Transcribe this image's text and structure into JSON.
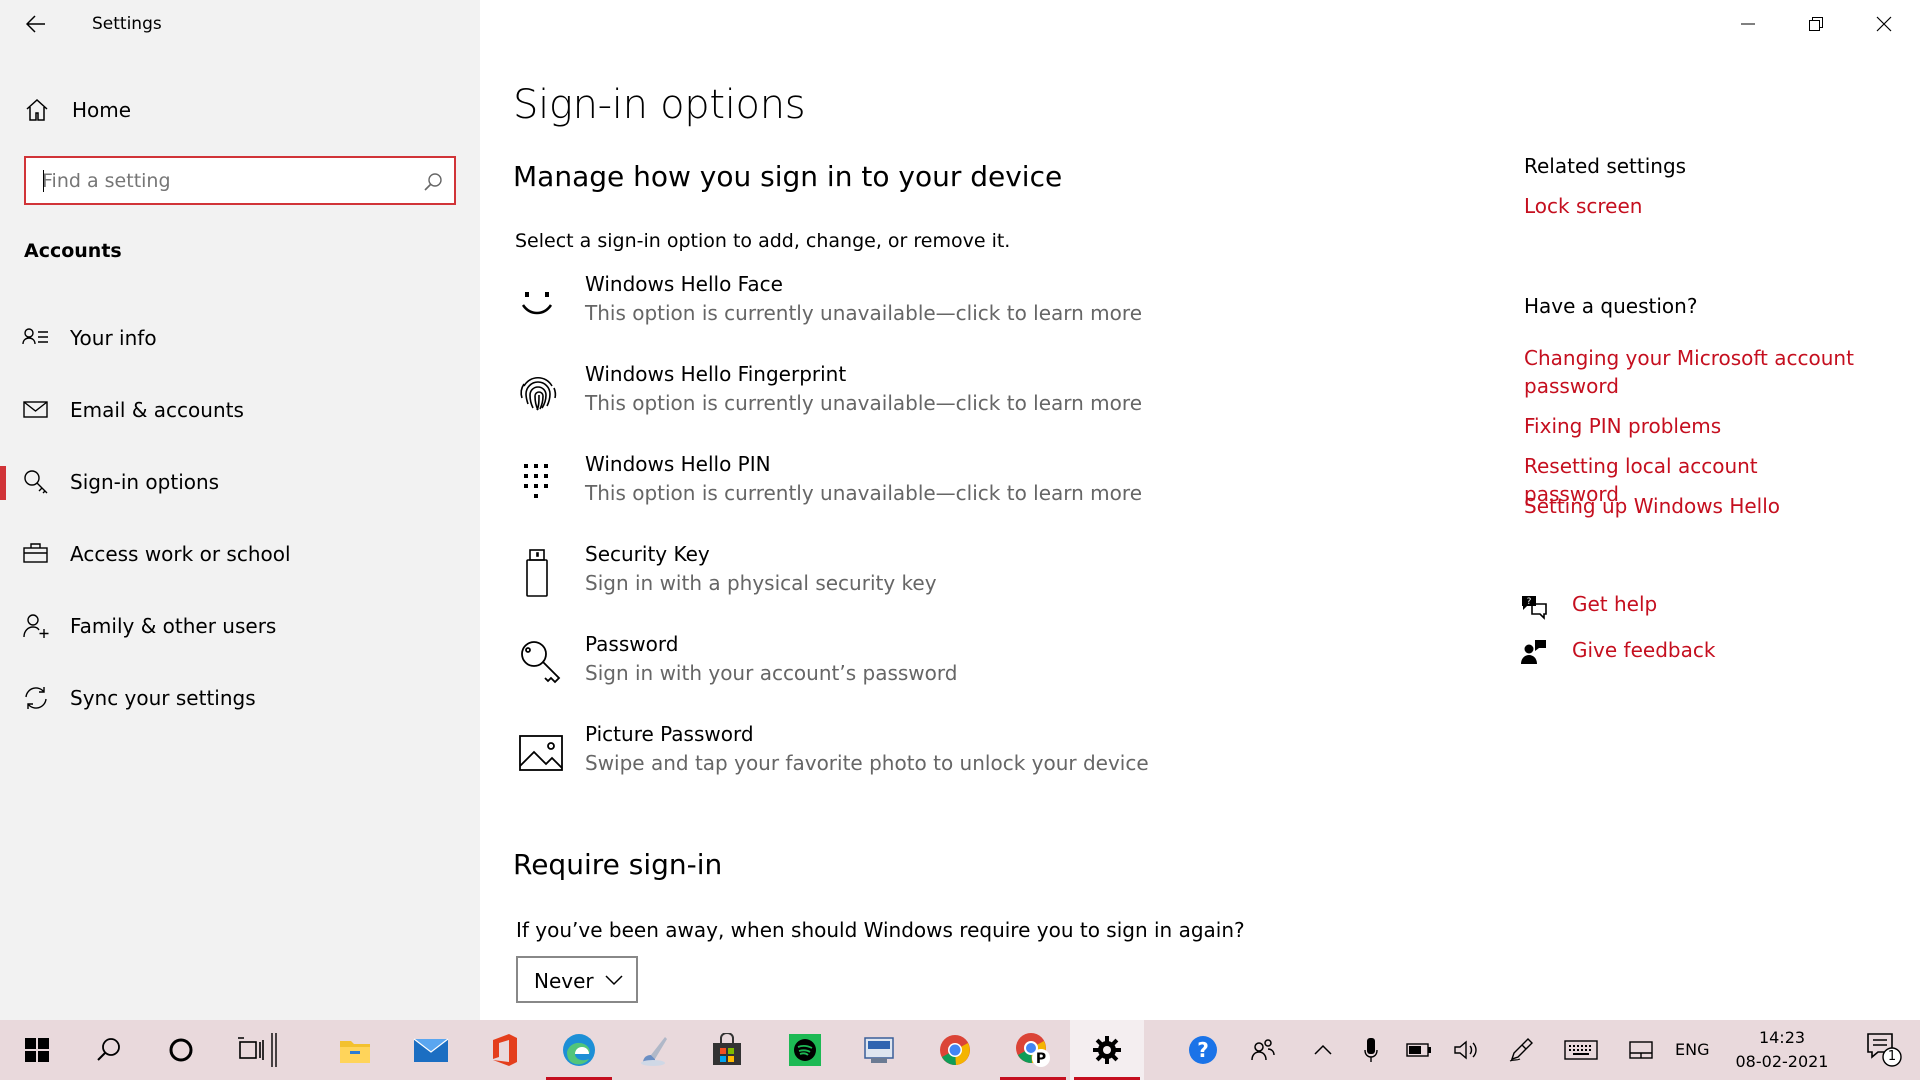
{
  "window": {
    "title": "Settings",
    "controls": [
      "minimize",
      "restore",
      "close"
    ]
  },
  "sidebar": {
    "home_label": "Home",
    "search_placeholder": "Find a setting",
    "section_header": "Accounts",
    "items": [
      {
        "label": "Your info",
        "icon": "person-card-icon"
      },
      {
        "label": "Email & accounts",
        "icon": "mail-icon"
      },
      {
        "label": "Sign-in options",
        "icon": "key-icon",
        "selected": true
      },
      {
        "label": "Access work or school",
        "icon": "briefcase-icon"
      },
      {
        "label": "Family & other users",
        "icon": "person-add-icon"
      },
      {
        "label": "Sync your settings",
        "icon": "sync-icon"
      }
    ]
  },
  "main": {
    "title": "Sign-in options",
    "subtitle": "Manage how you sign in to your device",
    "intro": "Select a sign-in option to add, change, or remove it.",
    "options": [
      {
        "name": "Windows Hello Face",
        "desc": "This option is currently unavailable—click to learn more",
        "icon": "face-icon"
      },
      {
        "name": "Windows Hello Fingerprint",
        "desc": "This option is currently unavailable—click to learn more",
        "icon": "fingerprint-icon"
      },
      {
        "name": "Windows Hello PIN",
        "desc": "This option is currently unavailable—click to learn more",
        "icon": "pin-keypad-icon"
      },
      {
        "name": "Security Key",
        "desc": "Sign in with a physical security key",
        "icon": "usb-key-icon"
      },
      {
        "name": "Password",
        "desc": "Sign in with your account’s password",
        "icon": "password-key-icon"
      },
      {
        "name": "Picture Password",
        "desc": "Swipe and tap your favorite photo to unlock your device",
        "icon": "picture-icon"
      }
    ],
    "require_title": "Require sign-in",
    "require_question": "If you’ve been away, when should Windows require you to sign in again?",
    "require_value": "Never"
  },
  "right": {
    "related_header": "Related settings",
    "related_links": [
      "Lock screen"
    ],
    "question_header": "Have a question?",
    "question_links": [
      "Changing your Microsoft account password",
      "Fixing PIN problems",
      "Resetting local account password",
      "Setting up Windows Hello"
    ],
    "get_help": "Get help",
    "give_feedback": "Give feedback"
  },
  "taskbar": {
    "apps": [
      "start-icon",
      "search-icon",
      "cortana-icon",
      "task-view-icon",
      "file-explorer-icon",
      "mail-app-icon",
      "office-icon",
      "edge-icon",
      "paint-brush-icon",
      "store-icon",
      "spotify-icon",
      "network-app-icon",
      "chrome-icon",
      "chrome-profile-icon",
      "settings-gear-icon"
    ],
    "tray_language": "ENG",
    "time": "14:23",
    "date": "08-02-2021",
    "notification_count": "1"
  },
  "colors": {
    "accent": "#c50f1f",
    "focus_border": "#d13438",
    "sidebar_bg": "#f2f2f2",
    "taskbar_bg": "#e9d9dc"
  }
}
